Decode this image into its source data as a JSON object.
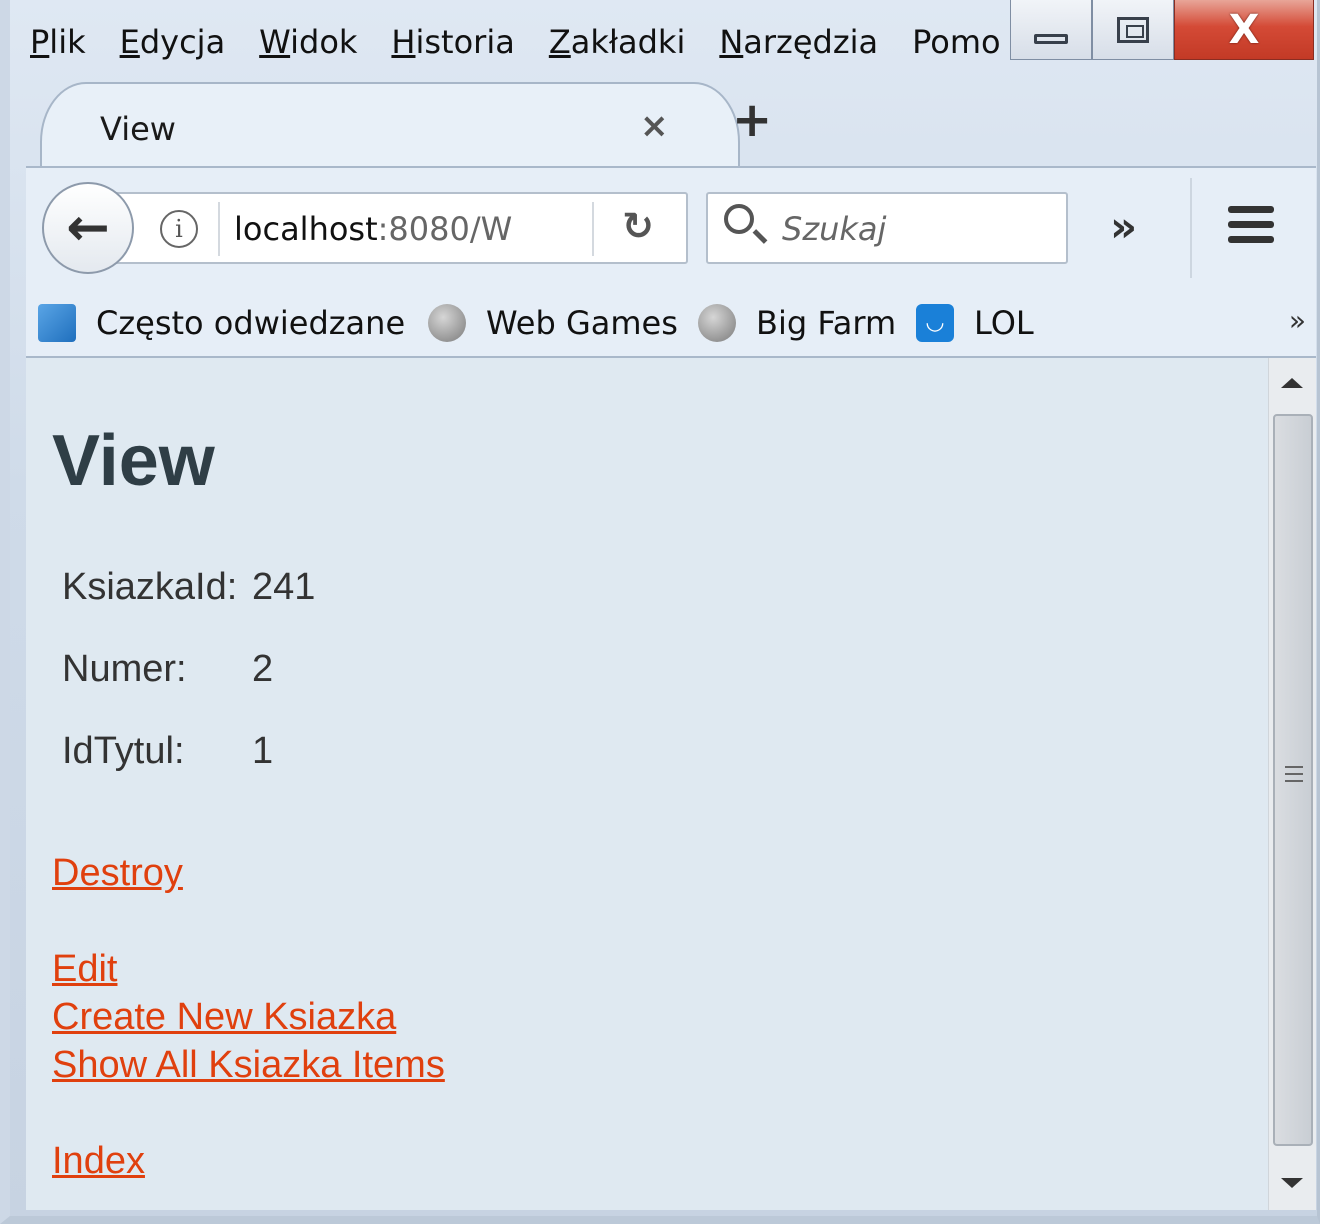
{
  "menu": [
    {
      "label_ul": "P",
      "label_rest": "lik"
    },
    {
      "label_ul": "E",
      "label_rest": "dycja"
    },
    {
      "label_ul": "W",
      "label_rest": "idok"
    },
    {
      "label_ul": "H",
      "label_rest": "istoria"
    },
    {
      "label_ul": "Z",
      "label_rest": "akładki"
    },
    {
      "label_ul": "N",
      "label_rest": "arzędzia"
    },
    {
      "label_ul": "",
      "label_rest": "Pomo"
    }
  ],
  "tab": {
    "title": "View",
    "close": "×",
    "new": "+"
  },
  "nav": {
    "url_host": "localhost",
    "url_rest": ":8080/W",
    "search_placeholder": "Szukaj",
    "overflow": "»"
  },
  "bookmarks": {
    "items": [
      {
        "label": "Często odwiedzane",
        "icon": "often-visited-icon"
      },
      {
        "label": "Web Games",
        "icon": "globe-icon"
      },
      {
        "label": "Big Farm",
        "icon": "globe-icon"
      },
      {
        "label": "LOL",
        "icon": "lol-icon"
      }
    ],
    "more": "»"
  },
  "page": {
    "title": "View",
    "fields": [
      {
        "label": "KsiazkaId:",
        "value": "241"
      },
      {
        "label": "Numer:",
        "value": "2"
      },
      {
        "label": "IdTytul:",
        "value": "1"
      }
    ],
    "links": {
      "destroy": "Destroy",
      "edit": "Edit",
      "create": "Create New Ksiazka",
      "show_all": "Show All Ksiazka Items",
      "index": "Index"
    }
  },
  "colors": {
    "link": "#e0400e",
    "heading": "#2f3e46",
    "content_bg": "#dfe9f1"
  }
}
